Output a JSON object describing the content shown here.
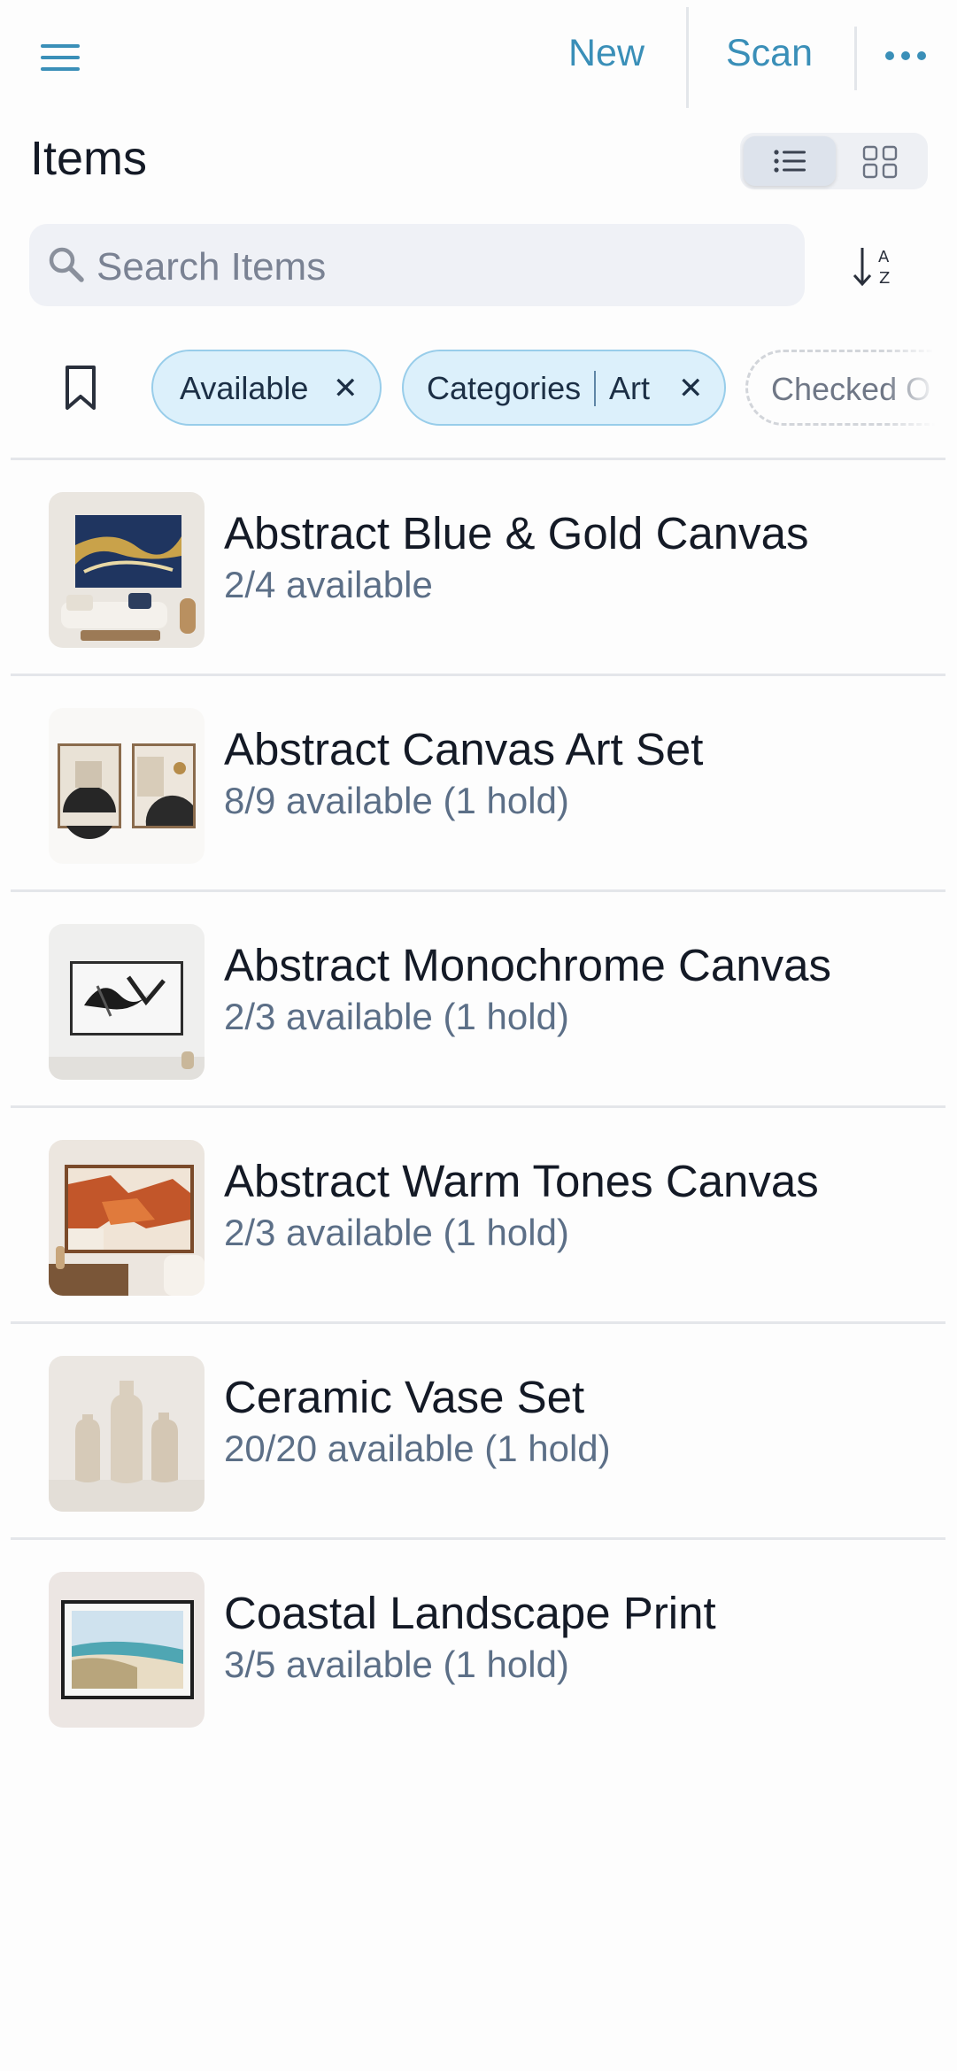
{
  "header": {
    "new_label": "New",
    "scan_label": "Scan"
  },
  "page": {
    "title": "Items"
  },
  "search": {
    "placeholder": "Search Items"
  },
  "filters": {
    "chips": [
      {
        "label": "Available"
      },
      {
        "category": "Categories",
        "value": "Art"
      },
      {
        "label": "Checked O"
      }
    ]
  },
  "items": [
    {
      "name": "Abstract Blue & Gold Canvas",
      "availability": "2/4 available"
    },
    {
      "name": "Abstract Canvas Art Set",
      "availability": "8/9 available (1 hold)"
    },
    {
      "name": "Abstract Monochrome Canvas",
      "availability": "2/3 available (1 hold)"
    },
    {
      "name": "Abstract Warm Tones Canvas",
      "availability": "2/3 available (1 hold)"
    },
    {
      "name": "Ceramic Vase Set",
      "availability": "20/20 available (1 hold)"
    },
    {
      "name": "Coastal Landscape Print",
      "availability": "3/5 available (1 hold)"
    }
  ],
  "colors": {
    "accent": "#3a8fb8",
    "chip_bg": "#dcf0fb",
    "secondary_text": "#5c6f87"
  }
}
